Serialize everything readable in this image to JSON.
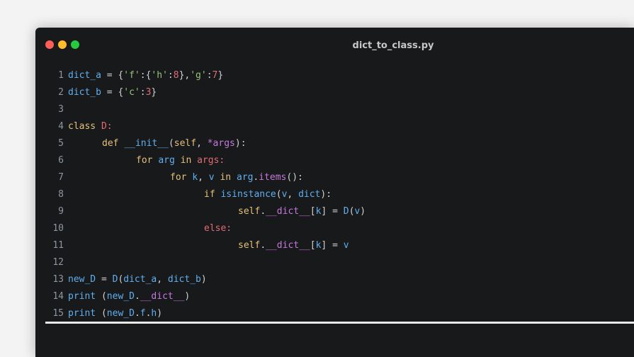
{
  "window": {
    "title": "dict_to_class.py",
    "traffic_lights": [
      {
        "name": "close",
        "color": "#ff5f56"
      },
      {
        "name": "minimize",
        "color": "#ffbd2e"
      },
      {
        "name": "maximize",
        "color": "#27c93f"
      }
    ]
  },
  "code": {
    "lines": [
      {
        "num": "1",
        "indent": 0,
        "tokens": [
          [
            "dict_a",
            "var"
          ],
          [
            " = ",
            "op"
          ],
          [
            "{",
            "punc"
          ],
          [
            "'f'",
            "str"
          ],
          [
            ":",
            "punc"
          ],
          [
            "{",
            "punc"
          ],
          [
            "'h'",
            "str"
          ],
          [
            ":",
            "punc"
          ],
          [
            "8",
            "num"
          ],
          [
            "},",
            "punc"
          ],
          [
            "'g'",
            "str"
          ],
          [
            ":",
            "punc"
          ],
          [
            "7",
            "num"
          ],
          [
            "}",
            "punc"
          ]
        ]
      },
      {
        "num": "2",
        "indent": 0,
        "tokens": [
          [
            "dict_b",
            "var"
          ],
          [
            " = ",
            "op"
          ],
          [
            "{",
            "punc"
          ],
          [
            "'c'",
            "str"
          ],
          [
            ":",
            "punc"
          ],
          [
            "3",
            "num"
          ],
          [
            "}",
            "punc"
          ]
        ]
      },
      {
        "num": "3",
        "indent": 0,
        "tokens": []
      },
      {
        "num": "4",
        "indent": 0,
        "tokens": [
          [
            "class ",
            "kw"
          ],
          [
            "D:",
            "cls"
          ]
        ]
      },
      {
        "num": "5",
        "indent": 1,
        "tokens": [
          [
            "def ",
            "kw"
          ],
          [
            "__init__",
            "var"
          ],
          [
            "(",
            "punc"
          ],
          [
            "self",
            "self"
          ],
          [
            ", ",
            "punc"
          ],
          [
            "*args",
            "attr"
          ],
          [
            "):",
            "punc"
          ]
        ]
      },
      {
        "num": "6",
        "indent": 2,
        "tokens": [
          [
            "for ",
            "kw"
          ],
          [
            "arg ",
            "var"
          ],
          [
            "in ",
            "kw"
          ],
          [
            "args:",
            "cls"
          ]
        ]
      },
      {
        "num": "7",
        "indent": 3,
        "tokens": [
          [
            "for ",
            "kw"
          ],
          [
            "k",
            "var"
          ],
          [
            ", ",
            "punc"
          ],
          [
            "v ",
            "var"
          ],
          [
            "in ",
            "kw"
          ],
          [
            "arg",
            "var"
          ],
          [
            ".",
            "punc"
          ],
          [
            "items",
            "attr"
          ],
          [
            "():",
            "punc"
          ]
        ]
      },
      {
        "num": "8",
        "indent": 4,
        "tokens": [
          [
            "if ",
            "kw"
          ],
          [
            "isinstance",
            "builtin"
          ],
          [
            "(",
            "punc"
          ],
          [
            "v",
            "var"
          ],
          [
            ", ",
            "punc"
          ],
          [
            "dict",
            "builtin"
          ],
          [
            "):",
            "punc"
          ]
        ]
      },
      {
        "num": "9",
        "indent": 5,
        "tokens": [
          [
            "self",
            "self"
          ],
          [
            ".",
            "punc"
          ],
          [
            "__dict__",
            "attr"
          ],
          [
            "[",
            "punc"
          ],
          [
            "k",
            "var"
          ],
          [
            "]",
            "punc"
          ],
          [
            " = ",
            "op"
          ],
          [
            "D",
            "var"
          ],
          [
            "(",
            "punc"
          ],
          [
            "v",
            "var"
          ],
          [
            ")",
            "punc"
          ]
        ]
      },
      {
        "num": "10",
        "indent": 4,
        "tokens": [
          [
            "else:",
            "cls"
          ]
        ]
      },
      {
        "num": "11",
        "indent": 5,
        "tokens": [
          [
            "self",
            "self"
          ],
          [
            ".",
            "punc"
          ],
          [
            "__dict__",
            "attr"
          ],
          [
            "[",
            "punc"
          ],
          [
            "k",
            "var"
          ],
          [
            "]",
            "punc"
          ],
          [
            " = ",
            "op"
          ],
          [
            "v",
            "var"
          ]
        ]
      },
      {
        "num": "12",
        "indent": 0,
        "tokens": []
      },
      {
        "num": "13",
        "indent": 0,
        "tokens": [
          [
            "new_D",
            "var"
          ],
          [
            " = ",
            "op"
          ],
          [
            "D",
            "var"
          ],
          [
            "(",
            "punc"
          ],
          [
            "dict_a",
            "var"
          ],
          [
            ", ",
            "punc"
          ],
          [
            "dict_b",
            "var"
          ],
          [
            ")",
            "punc"
          ]
        ]
      },
      {
        "num": "14",
        "indent": 0,
        "tokens": [
          [
            "print ",
            "var"
          ],
          [
            "(",
            "punc"
          ],
          [
            "new_D",
            "var"
          ],
          [
            ".",
            "punc"
          ],
          [
            "__dict__",
            "attr"
          ],
          [
            ")",
            "punc"
          ]
        ]
      },
      {
        "num": "15",
        "indent": 0,
        "tokens": [
          [
            "print ",
            "var"
          ],
          [
            "(",
            "punc"
          ],
          [
            "new_D",
            "var"
          ],
          [
            ".",
            "punc"
          ],
          [
            "f",
            "var"
          ],
          [
            ".",
            "punc"
          ],
          [
            "h",
            "var"
          ],
          [
            ")",
            "punc"
          ]
        ]
      }
    ]
  }
}
